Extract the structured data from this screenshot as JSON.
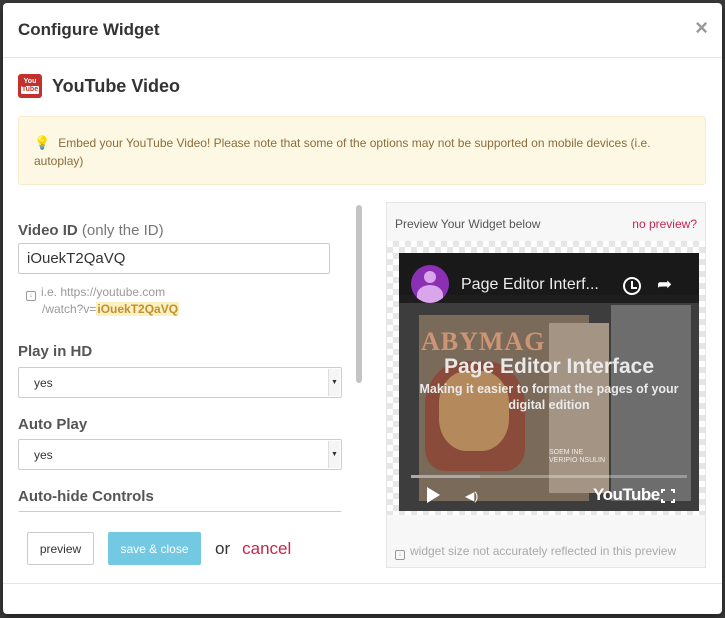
{
  "dialog": {
    "title": "Configure Widget",
    "close_label": "×"
  },
  "widget": {
    "title": "YouTube Video",
    "logo_top": "You",
    "logo_bottom": "Tube"
  },
  "alert": {
    "text": "Embed your YouTube Video! Please note that some of the options may not be supported on mobile devices (i.e. autoplay)"
  },
  "form": {
    "video_id_label": "Video ID",
    "video_id_hint_label": "(only the ID)",
    "video_id_value": "iOuekT2QaVQ",
    "hint_line1": "i.e. https://youtube.com",
    "hint_line2_prefix": "/watch?v=",
    "hint_highlight": "iOuekT2QaVQ",
    "play_hd_label": "Play in HD",
    "play_hd_value": "yes",
    "auto_play_label": "Auto Play",
    "auto_play_value": "yes",
    "auto_hide_label": "Auto-hide Controls"
  },
  "preview": {
    "heading": "Preview Your Widget below",
    "no_preview_link": "no preview?",
    "size_note": "widget size not accurately reflected in this preview",
    "video": {
      "title": "Page Editor Interf...",
      "overlay_title": "Page Editor Interface",
      "overlay_subtitle": "Making it easier to format the pages of your digital edition",
      "magazine_title": "ABYMAG",
      "magazine_small_text": "SOEM INE VERIPIO NSULIN",
      "brand": "YouTube",
      "progress": 0.25
    }
  },
  "footer": {
    "preview_button": "preview",
    "save_button": "save & close",
    "or_text": "or",
    "cancel_link": "cancel"
  },
  "colors": {
    "accent_link": "#c7254e",
    "save_button": "#5bc0de",
    "alert_bg": "#fcf8e3",
    "youtube_red": "#c4302b"
  }
}
